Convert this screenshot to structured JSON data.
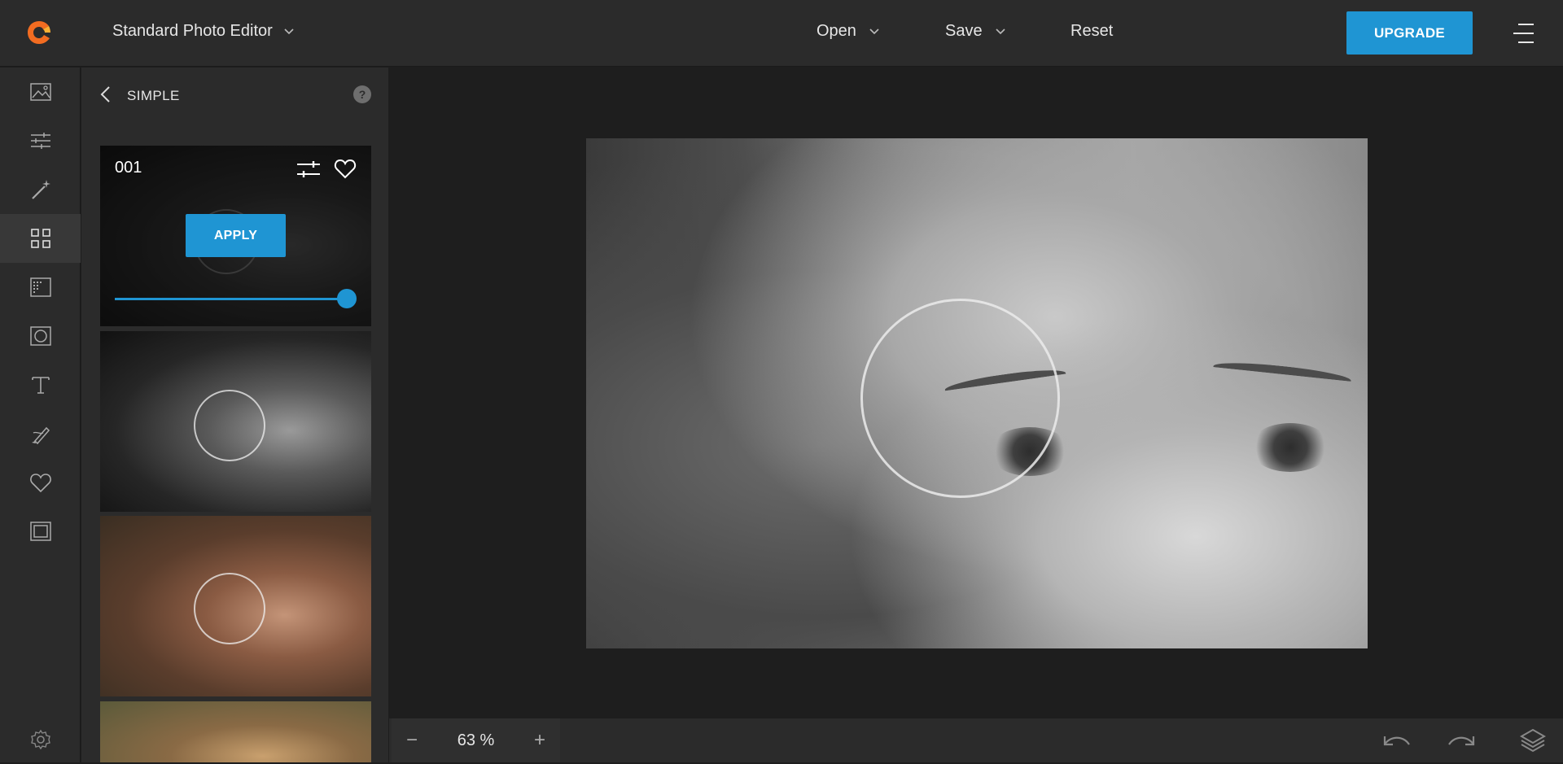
{
  "header": {
    "app_title": "Standard Photo Editor",
    "menu": {
      "open": "Open",
      "save": "Save",
      "reset": "Reset"
    },
    "upgrade_label": "UPGRADE",
    "accent_color": "#1f95d3"
  },
  "rail": {
    "items": [
      "image-icon",
      "sliders-icon",
      "magic-wand-icon",
      "grid-icon",
      "texture-icon",
      "vignette-icon",
      "text-icon",
      "brush-icon",
      "heart-icon",
      "frame-icon"
    ],
    "settings": "gear-icon"
  },
  "panel": {
    "title": "SIMPLE",
    "help": "?",
    "selected_filter": {
      "label": "001",
      "apply_label": "APPLY",
      "intensity_fraction": 1.0
    }
  },
  "footer": {
    "zoom_out": "−",
    "zoom_value": "63 %",
    "zoom_in": "+"
  }
}
